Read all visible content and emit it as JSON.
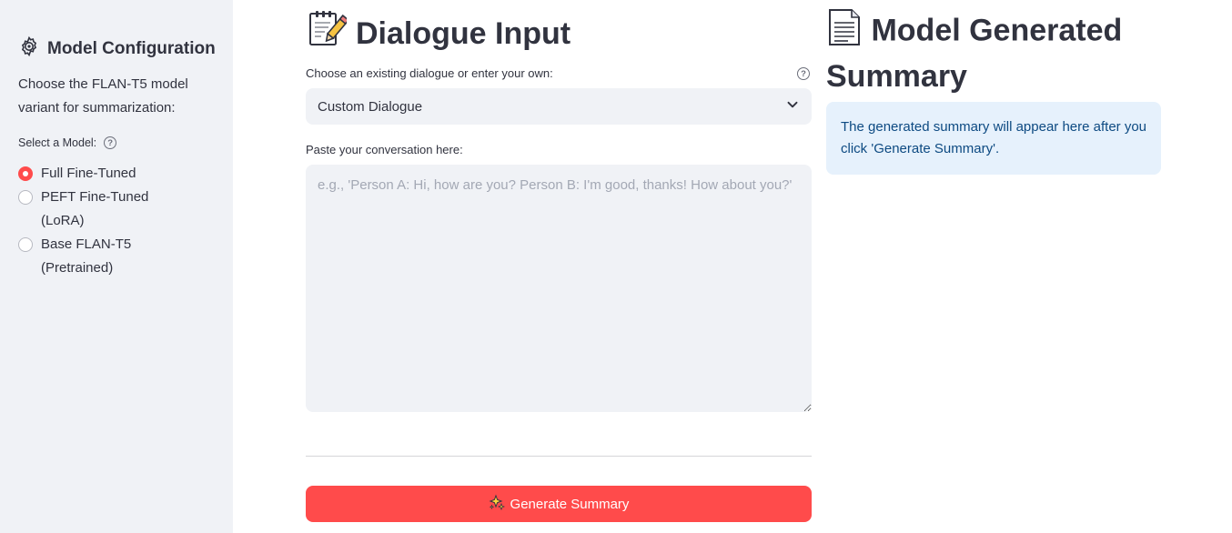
{
  "sidebar": {
    "title": "Model Configuration",
    "title_icon": "gear-icon",
    "description": "Choose the FLAN-T5 model variant for summarization:",
    "select_label": "Select a Model:",
    "options": [
      {
        "label": "Full Fine-Tuned",
        "selected": true
      },
      {
        "label": "PEFT Fine-Tuned (LoRA)",
        "selected": false
      },
      {
        "label": "Base FLAN-T5 (Pretrained)",
        "selected": false
      }
    ]
  },
  "dialogue": {
    "heading": "Dialogue Input",
    "heading_icon": "memo-icon",
    "choose_label": "Choose an existing dialogue or enter your own:",
    "selected_value": "Custom Dialogue",
    "textarea_label": "Paste your conversation here:",
    "textarea_value": "",
    "textarea_placeholder": "e.g., 'Person A: Hi, how are you? Person B: I'm good, thanks! How about you?'",
    "button_label": "Generate Summary",
    "button_icon": "sparkles-icon"
  },
  "summary": {
    "heading": "Model Generated Summary",
    "heading_icon": "page-icon",
    "info_text": "The generated summary will appear here after you click 'Generate Summary'."
  },
  "colors": {
    "accent": "#ff4b4b",
    "sidebar_bg": "#f0f2f6",
    "info_bg": "#e6f1fc",
    "info_text": "#0d4a82"
  }
}
